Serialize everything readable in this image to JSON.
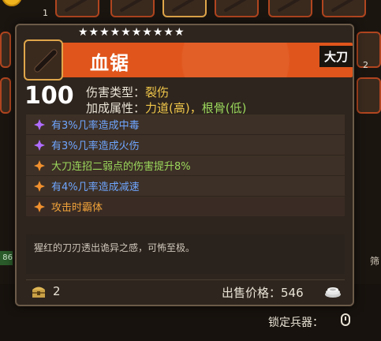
{
  "background": {
    "slot_number_1": "1",
    "slot_number_2": "2",
    "side_number": "86",
    "side_label": "筛",
    "lock_label": "锁定兵器：",
    "lock_icon": "mouse-icon"
  },
  "item": {
    "name": "血锯",
    "type_tag": "大刀",
    "stars": "★★★★★★★★★★",
    "star_count": 10,
    "power": "100",
    "damage_type_label": "伤害类型：",
    "damage_type_value": "裂伤",
    "bonus_label": "加成属性：",
    "bonus_value_1": "力道(高)",
    "bonus_sep": "，",
    "bonus_value_2": "根骨(低)",
    "affixes": [
      {
        "text": "有3%几率造成中毒",
        "color": "#6fa6ff",
        "icon": "purple-diamond-icon",
        "icon_color": "#b06cff"
      },
      {
        "text": "有3%几率造成火伤",
        "color": "#6fa6ff",
        "icon": "purple-diamond-icon",
        "icon_color": "#b06cff"
      },
      {
        "text": "大刀连招二弱点的伤害提升8%",
        "color": "#9bd85c",
        "icon": "orange-diamond-icon",
        "icon_color": "#f0902e"
      },
      {
        "text": "有4%几率造成减速",
        "color": "#6fa6ff",
        "icon": "orange-diamond-icon",
        "icon_color": "#f0902e"
      },
      {
        "text": "攻击时霸体",
        "color": "#f0a23a",
        "icon": "orange-diamond-icon",
        "icon_color": "#f0902e"
      }
    ],
    "description": "猩红的刀刃透出诡异之感，可怖至极。",
    "count": "2",
    "price_label": "出售价格：",
    "price_value": "546"
  },
  "colors": {
    "header": "#e0551b",
    "accent_gold": "#f2c84a",
    "accent_green": "#9bd85c"
  }
}
